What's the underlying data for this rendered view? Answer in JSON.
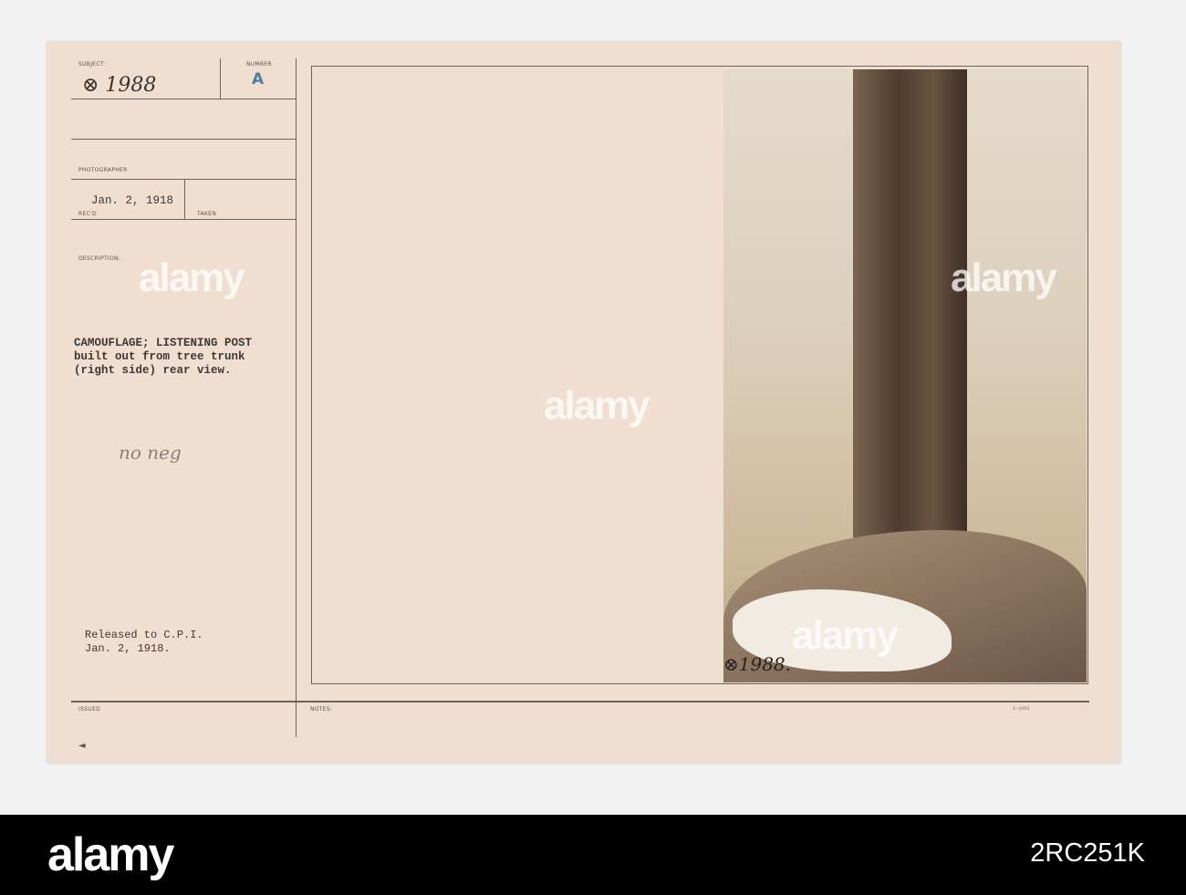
{
  "card": {
    "subject_label": "SUBJECT:",
    "subject_value": "⊗ 1988",
    "number_label": "NUMBER",
    "number_value": "A",
    "photographer_label": "PHOTOGRAPHER",
    "recd_value": "Jan. 2, 1918",
    "recd_label": "REC'D",
    "taken_label": "TAKEN",
    "description_label": "DESCRIPTION:",
    "description": "CAMOUFLAGE; LISTENING POST\nbuilt out from tree trunk\n(right side) rear view.",
    "handwritten_note": "no neg",
    "release": "Released to C.P.I.\nJan. 2, 1918.",
    "issued_label": "ISSUED",
    "notes_label": "NOTES:",
    "form_number": "3—2003",
    "photo_caption": "⊗1988.",
    "issued_mark": "◄"
  },
  "watermark": {
    "text": "alamy"
  },
  "banner": {
    "logo": "alamy",
    "image_id": "2RC251K"
  }
}
